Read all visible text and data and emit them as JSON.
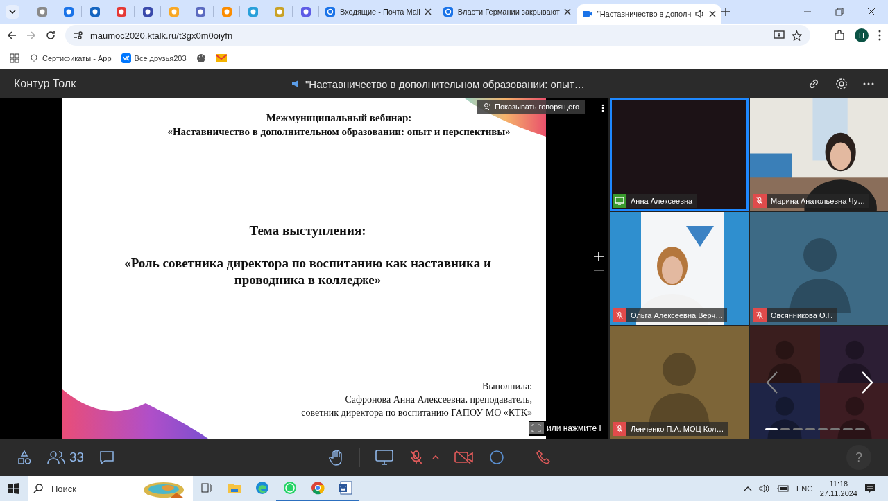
{
  "browser": {
    "pinned_tabs": [
      {
        "color": "#8a8a8a"
      },
      {
        "color": "#1a73e8"
      },
      {
        "color": "#1565c0"
      },
      {
        "color": "#e53935"
      },
      {
        "color": "#3949ab"
      },
      {
        "color": "#f9a825"
      },
      {
        "color": "#5c6bc0"
      },
      {
        "color": "#fb8c00"
      },
      {
        "color": "#29a0da"
      },
      {
        "color": "#c9a227"
      },
      {
        "color": "#5e5ce6"
      }
    ],
    "tabs": [
      {
        "title": "Входящие - Почта Mail",
        "selected": false,
        "audio": false
      },
      {
        "title": "Власти Германии закрывают",
        "selected": false,
        "audio": false
      },
      {
        "title": "\"Наставничество в дополн",
        "selected": true,
        "audio": true
      }
    ],
    "address": "maumoc2020.ktalk.ru/t3gx0m0oiyfn",
    "profile_initial": "П",
    "bookmarks": [
      {
        "label": "Сертификаты - App",
        "kind": "bulb"
      },
      {
        "label": "Все друзья203",
        "kind": "vk"
      },
      {
        "kind": "globe"
      },
      {
        "kind": "mail"
      }
    ]
  },
  "app": {
    "brand": "Контур Толк",
    "meeting_title": "\"Наставничество в дополнительном образовании: опыт…",
    "slide": {
      "header": [
        "Межмуниципальный вебинар:",
        "«Наставничество в дополнительном образовании: опыт и перспективы»"
      ],
      "topic_label": "Тема выступления:",
      "topic": "«Роль советника директора по воспитанию как наставника и проводника в колледже»",
      "signature": [
        "Выполнила:",
        "Сафронова Анна Алексеевна, преподаватель,",
        "советник директора по воспитанию ГАПОУ МО «КТК»"
      ]
    },
    "show_speaker_button": "Показывать говорящего",
    "fullscreen_hint": "или нажмите F",
    "tiles": [
      {
        "kind": "screen",
        "name": "Анна Алексеевна",
        "sharing": true,
        "selected": true
      },
      {
        "kind": "video",
        "name": "Марина Анатольевна Чу…",
        "sharing": false,
        "muted": true,
        "selected": false
      },
      {
        "kind": "video",
        "name": "Ольга Алексеевна Верч…",
        "sharing": false,
        "muted": true,
        "selected": false
      },
      {
        "kind": "avatar",
        "name": "Овсянникова О.Г.",
        "sharing": false,
        "muted": true,
        "selected": false,
        "color": "#3d6a85"
      },
      {
        "kind": "avatar",
        "name": "Ленченко П.А. МОЦ Кол…",
        "sharing": false,
        "muted": true,
        "selected": false,
        "color": "#7d6538"
      },
      {
        "kind": "more",
        "selected": false
      }
    ],
    "pages": [
      {
        "selected": true
      },
      {
        "selected": false
      },
      {
        "selected": false
      },
      {
        "selected": false
      },
      {
        "selected": false
      },
      {
        "selected": false
      },
      {
        "selected": false
      },
      {
        "selected": false
      }
    ],
    "participants_count": "33",
    "mic_on": false,
    "camera_on": false,
    "help": "?"
  },
  "taskbar": {
    "search_placeholder": "Поиск",
    "apps": [
      {
        "kind": "explorer",
        "running": false
      },
      {
        "kind": "edge",
        "running": false
      },
      {
        "kind": "whatsapp",
        "running": true
      },
      {
        "kind": "chrome",
        "running": true
      },
      {
        "kind": "word",
        "running": true
      }
    ],
    "language": "ENG",
    "time": "11:18",
    "date": "27.11.2024"
  }
}
